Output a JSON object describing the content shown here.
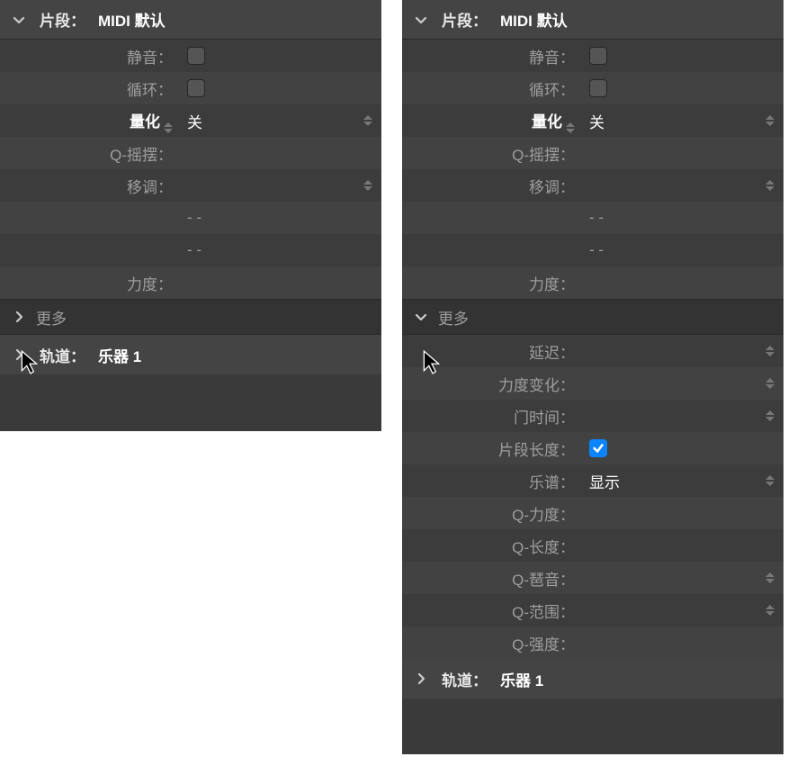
{
  "left": {
    "header": {
      "label": "片段：",
      "value": "MIDI 默认"
    },
    "rows": {
      "mute": "静音：",
      "loop": "循环：",
      "quantize_label": "量化",
      "quantize_value": "关",
      "qswing": "Q-摇摆：",
      "transpose": "移调：",
      "dash1": "-  -",
      "dash2": "-  -",
      "velocity": "力度："
    },
    "more": "更多",
    "track": {
      "label": "轨道：",
      "value": "乐器 1"
    }
  },
  "right": {
    "header": {
      "label": "片段：",
      "value": "MIDI 默认"
    },
    "rows": {
      "mute": "静音：",
      "loop": "循环：",
      "quantize_label": "量化",
      "quantize_value": "关",
      "qswing": "Q-摇摆：",
      "transpose": "移调：",
      "dash1": "-  -",
      "dash2": "-  -",
      "velocity": "力度："
    },
    "more": "更多",
    "more_rows": {
      "delay": "延迟：",
      "velchange": "力度变化：",
      "gatetime": "门时间：",
      "regionlen": "片段长度：",
      "score_label": "乐谱：",
      "score_value": "显示",
      "qvel": "Q-力度：",
      "qlen": "Q-长度：",
      "qarp": "Q-琶音：",
      "qrange": "Q-范围：",
      "qstr": "Q-强度："
    },
    "track": {
      "label": "轨道：",
      "value": "乐器 1"
    }
  }
}
